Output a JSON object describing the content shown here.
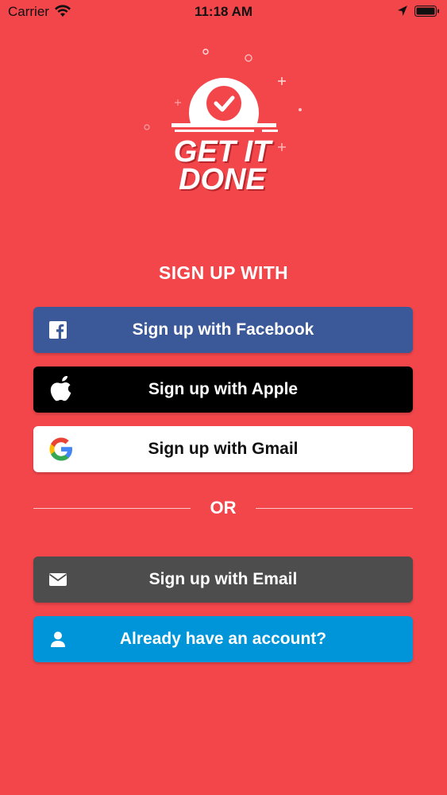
{
  "status_bar": {
    "carrier": "Carrier",
    "time": "11:18 AM"
  },
  "logo": {
    "line1": "GET IT",
    "line2": "DONE"
  },
  "heading": "SIGN UP WITH",
  "buttons": {
    "facebook": "Sign up with Facebook",
    "apple": "Sign up with Apple",
    "gmail": "Sign up with Gmail",
    "email": "Sign up with Email",
    "login": "Already have an account?"
  },
  "divider": "OR",
  "colors": {
    "background": "#f2464b",
    "facebook": "#3b5998",
    "apple": "#000000",
    "gmail": "#ffffff",
    "email": "#4d4d4d",
    "login": "#0095d9"
  },
  "icons": {
    "facebook": "facebook-icon",
    "apple": "apple-icon",
    "gmail": "google-icon",
    "email": "envelope-icon",
    "login": "user-icon"
  }
}
